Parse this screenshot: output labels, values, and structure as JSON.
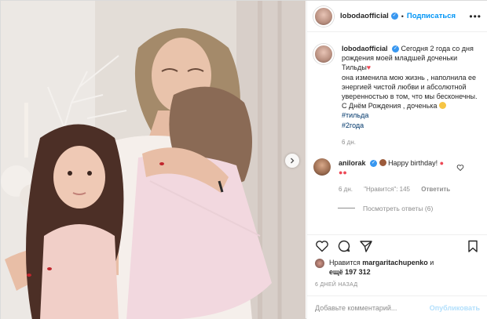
{
  "post": {
    "username": "lobodaofficial",
    "follow_label": "Подписаться",
    "separator": "•",
    "more_label": "•••"
  },
  "caption": {
    "username": "lobodaofficial",
    "line1": "Сегодня 2 года со дня рождения моей младшей доченьки Тильды",
    "line2": "она изменила мою жизнь , наполнила ее энергией чистой любви и абсолютной уверенностью в том, что мы бесконечны.",
    "line3": "С Днём Рождения , доченька",
    "hashtag1": "#тильда",
    "hashtag2": "#2года",
    "age": "6 дн."
  },
  "comment": {
    "username": "anilorak",
    "text": "Happy birthday!",
    "age": "6 дн.",
    "likes": "\"Нравится\": 145",
    "reply": "Ответить",
    "view_replies": "Посмотреть ответы (6)"
  },
  "likes": {
    "prefix": "Нравится",
    "user": "margaritachupenko",
    "conj": "и",
    "rest": "ещё 197 312"
  },
  "time": "6 ДНЕЙ НАЗАД",
  "comment_box": {
    "placeholder": "Добавьте комментарий...",
    "publish": "Опубликовать"
  },
  "icons": [
    "verified-icon",
    "more-icon",
    "next-arrow-icon",
    "heart-icon",
    "comment-icon",
    "share-icon",
    "bookmark-icon"
  ],
  "colors": {
    "link": "#0095f6",
    "heart": "#ed4956",
    "hashtag": "#00376b",
    "muted": "#8e8e8e"
  }
}
